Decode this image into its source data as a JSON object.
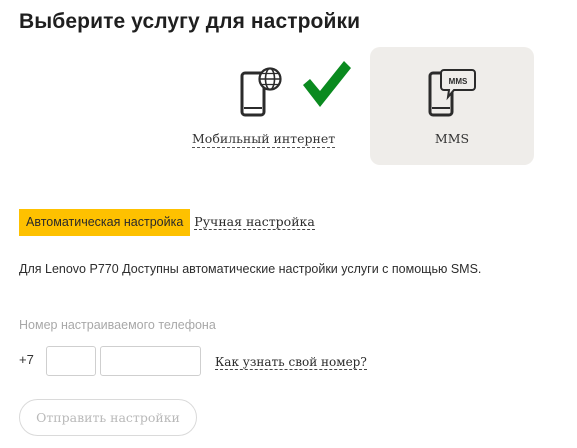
{
  "page": {
    "title": "Выберите услугу для настройки"
  },
  "services": [
    {
      "label": "Мобильный интернет",
      "icon": "phone-globe-icon",
      "selected": true
    },
    {
      "label": "MMS",
      "icon": "phone-mms-icon",
      "selected": false,
      "icon_text": "MMS"
    }
  ],
  "selection_mark": {
    "icon": "checkmark-icon",
    "color": "#0a8a1f"
  },
  "mode_tabs": {
    "auto_label": "Автоматическая настройка",
    "manual_label": "Ручная настройка",
    "active_color": "#fec100"
  },
  "info_text": "Для Lenovo P770 Доступны автоматические настройки услуги с помощью SMS.",
  "phone_form": {
    "label": "Номер настраиваемого телефона",
    "country_code": "+7",
    "code_value": "",
    "number_value": "",
    "help_link": "Как узнать свой номер?"
  },
  "send_button": {
    "label": "Отправить настройки",
    "disabled": true
  }
}
